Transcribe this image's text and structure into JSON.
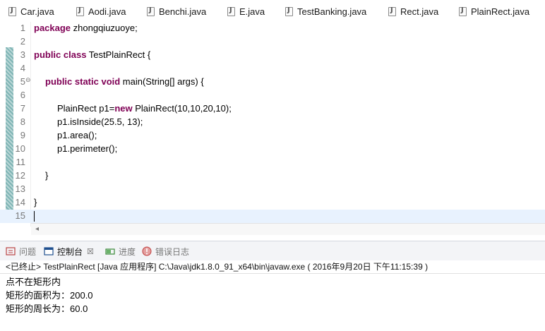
{
  "editor_tabs": [
    {
      "label": "Car.java"
    },
    {
      "label": "Aodi.java"
    },
    {
      "label": "Benchi.java"
    },
    {
      "label": "E.java"
    },
    {
      "label": "TestBanking.java"
    },
    {
      "label": "Rect.java"
    },
    {
      "label": "PlainRect.java"
    }
  ],
  "code": {
    "line_numbers": [
      "1",
      "2",
      "3",
      "4",
      "5",
      "6",
      "7",
      "8",
      "9",
      "10",
      "11",
      "12",
      "13",
      "14",
      "15"
    ],
    "l1": {
      "kw": "package",
      "rest": " zhongqiuzuoye;"
    },
    "l3": {
      "kw": "public class",
      "rest": " TestPlainRect {"
    },
    "l5": {
      "kw": "public static void",
      "rest": " main(String[] args) {"
    },
    "l7": {
      "a": "PlainRect p1=",
      "kw": "new",
      "b": " PlainRect(10,10,20,10);"
    },
    "l8": {
      "text": "p1.isInside(25.5, 13);"
    },
    "l9": {
      "text": "p1.area();"
    },
    "l10": {
      "text": "p1.perimeter();"
    },
    "l12": {
      "text": "}"
    },
    "l14": {
      "text": "}"
    }
  },
  "views": {
    "tabs": [
      {
        "label": "问题"
      },
      {
        "label": "控制台"
      },
      {
        "label": "进度"
      },
      {
        "label": "错误日志"
      }
    ],
    "close_glyph": "☒"
  },
  "console": {
    "status": "<已终止> TestPlainRect [Java 应用程序] C:\\Java\\jdk1.8.0_91_x64\\bin\\javaw.exe ( 2016年9月20日 下午11:15:39 )",
    "lines": [
      "点不在矩形内",
      "矩形的面积为：200.0",
      "矩形的周长为：60.0"
    ]
  },
  "colors": {
    "keyword": "#7f0055",
    "current_line": "#e8f2fe",
    "ruler": "#7fb5b5"
  }
}
